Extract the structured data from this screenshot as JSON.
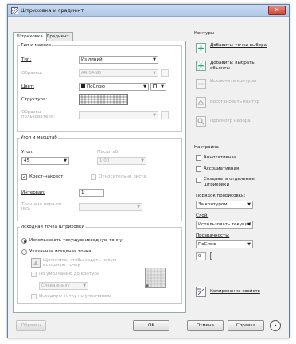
{
  "window": {
    "title": "Штриховка и градиент",
    "close": "✕"
  },
  "tabs": [
    {
      "label": "Штриховка"
    },
    {
      "label": "Градиент"
    }
  ],
  "type_pattern": {
    "legend": "Тип и массив",
    "type_label": "Тип:",
    "type_value": "Из линий",
    "pattern_label": "Образец:",
    "pattern_value": "AR-SAND",
    "color_label": "Цвет:",
    "color_value": "ПоСлою",
    "swatch_label": "Структура:",
    "custom_label": "Образец пользователя:"
  },
  "angle_scale": {
    "legend": "Угол и масштаб",
    "angle_label": "Угол:",
    "angle_value": "45",
    "scale_label": "Масштаб:",
    "scale_value": "1.00",
    "double_label": "Крест-накрест",
    "relative_label": "Относительно листа",
    "spacing_label": "Интервал:",
    "spacing_value": "1",
    "iso_label": "Толщина пера по ISO:"
  },
  "origin": {
    "legend": "Исходная точка штриховки",
    "current_label": "Использовать текущую исходную точку",
    "specified_label": "Указанная исходная точка",
    "click_label": "Щелкните, чтобы задать новую исходную точку",
    "default_boundary_label": "По умолчанию до контура",
    "position_value": "Слева внизу",
    "store_label": "Исходную точку по умолчанию"
  },
  "boundaries": {
    "legend": "Контуры",
    "add_pick": "Добавить: точки выбора",
    "add_select": "Добавить: выбрать объекты",
    "remove": "Исключить контуры",
    "recreate": "Восстановить контур",
    "view": "Просмотр набора"
  },
  "options": {
    "legend": "Настройка",
    "annotative": "Аннотативная",
    "associative": "Ассоциативная",
    "separate": "Создавать отдельные штриховки",
    "draw_order_label": "Порядок прорисовки:",
    "draw_order_value": "За контуром",
    "layer_label": "Слой:",
    "layer_value": "Использовать текущий",
    "transparency_label": "Прозрачность:",
    "transparency_value": "ПоСлою",
    "transparency_number": "0"
  },
  "inherit": {
    "label": "Копирование свойств"
  },
  "footer": {
    "preview": "Образец",
    "ok": "OK",
    "cancel": "Отмена",
    "help": "Справка",
    "more": "›"
  },
  "colors": {
    "title_bar": "#aec7e6",
    "close_button": "#c9463a",
    "accent": "#3d6fb5"
  }
}
